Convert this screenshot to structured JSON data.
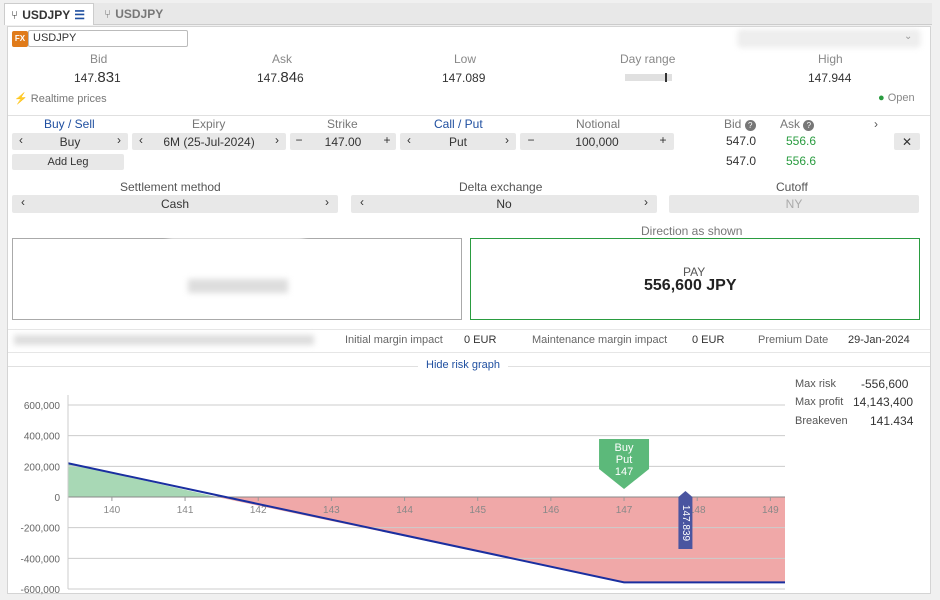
{
  "tabs": [
    {
      "label": "USDJPY"
    },
    {
      "label": "USDJPY"
    }
  ],
  "symbol": {
    "name": "USDJPY",
    "fx_badge": "FX"
  },
  "quote": {
    "bid_label": "Bid",
    "bid_small": "147.",
    "bid_big": "83",
    "bid_tail": "1",
    "ask_label": "Ask",
    "ask_small": "147.",
    "ask_big": "84",
    "ask_tail": "6",
    "low_label": "Low",
    "low": "147.089",
    "dayrange_label": "Day range",
    "high_label": "High",
    "high": "147.944"
  },
  "realtime": "Realtime prices",
  "status": "Open",
  "leg_headers": {
    "buysell": "Buy / Sell",
    "expiry": "Expiry",
    "strike": "Strike",
    "callput": "Call / Put",
    "notional": "Notional",
    "bid": "Bid",
    "ask": "Ask"
  },
  "leg": {
    "buysell": "Buy",
    "expiry": "6M (25-Jul-2024)",
    "strike": "147.00",
    "callput": "Put",
    "notional": "100,000",
    "bid": "547.0",
    "ask": "556.6",
    "total_bid": "547.0",
    "total_ask": "556.6"
  },
  "add_leg": "Add Leg",
  "settings": {
    "settlement_label": "Settlement method",
    "settlement": "Cash",
    "delta_label": "Delta exchange",
    "delta": "No",
    "cutoff_label": "Cutoff",
    "cutoff": "NY"
  },
  "direction": {
    "label": "Direction as shown",
    "pay_label": "PAY",
    "pay_amount": "556,600 JPY"
  },
  "margin": {
    "initial_label": "Initial margin impact",
    "initial": "0 EUR",
    "maint_label": "Maintenance margin impact",
    "maint": "0 EUR",
    "premium_label": "Premium Date",
    "premium": "29-Jan-2024"
  },
  "risk_toggle": "Hide risk graph",
  "risk_stats": {
    "max_risk_label": "Max risk",
    "max_risk": "-556,600",
    "max_profit_label": "Max profit",
    "max_profit": "14,143,400",
    "breakeven_label": "Breakeven",
    "breakeven": "141.434"
  },
  "colors": {
    "profit": "#a8d8b5",
    "loss": "#f0a8a8",
    "line": "#1a2fa0",
    "marker": "#5cb97a",
    "spot": "#4a55a0"
  },
  "chart_data": {
    "type": "area",
    "x_ticks": [
      "140",
      "141",
      "142",
      "143",
      "144",
      "145",
      "146",
      "147",
      "148",
      "149"
    ],
    "y_ticks": [
      "600,000",
      "400,000",
      "200,000",
      "0",
      "-200,000",
      "-400,000",
      "-600,000"
    ],
    "xlim": [
      139.4,
      149.2
    ],
    "ylim": [
      -600000,
      600000
    ],
    "series": [
      {
        "x": [
          139.4,
          147.0,
          149.2
        ],
        "y": [
          220000,
          -556600,
          -556600
        ]
      }
    ],
    "breakeven": 141.434,
    "marker": {
      "label_lines": [
        "Buy",
        "Put",
        "147"
      ],
      "x": 147.0
    },
    "spot": {
      "label": "147.839",
      "x": 147.839
    }
  }
}
